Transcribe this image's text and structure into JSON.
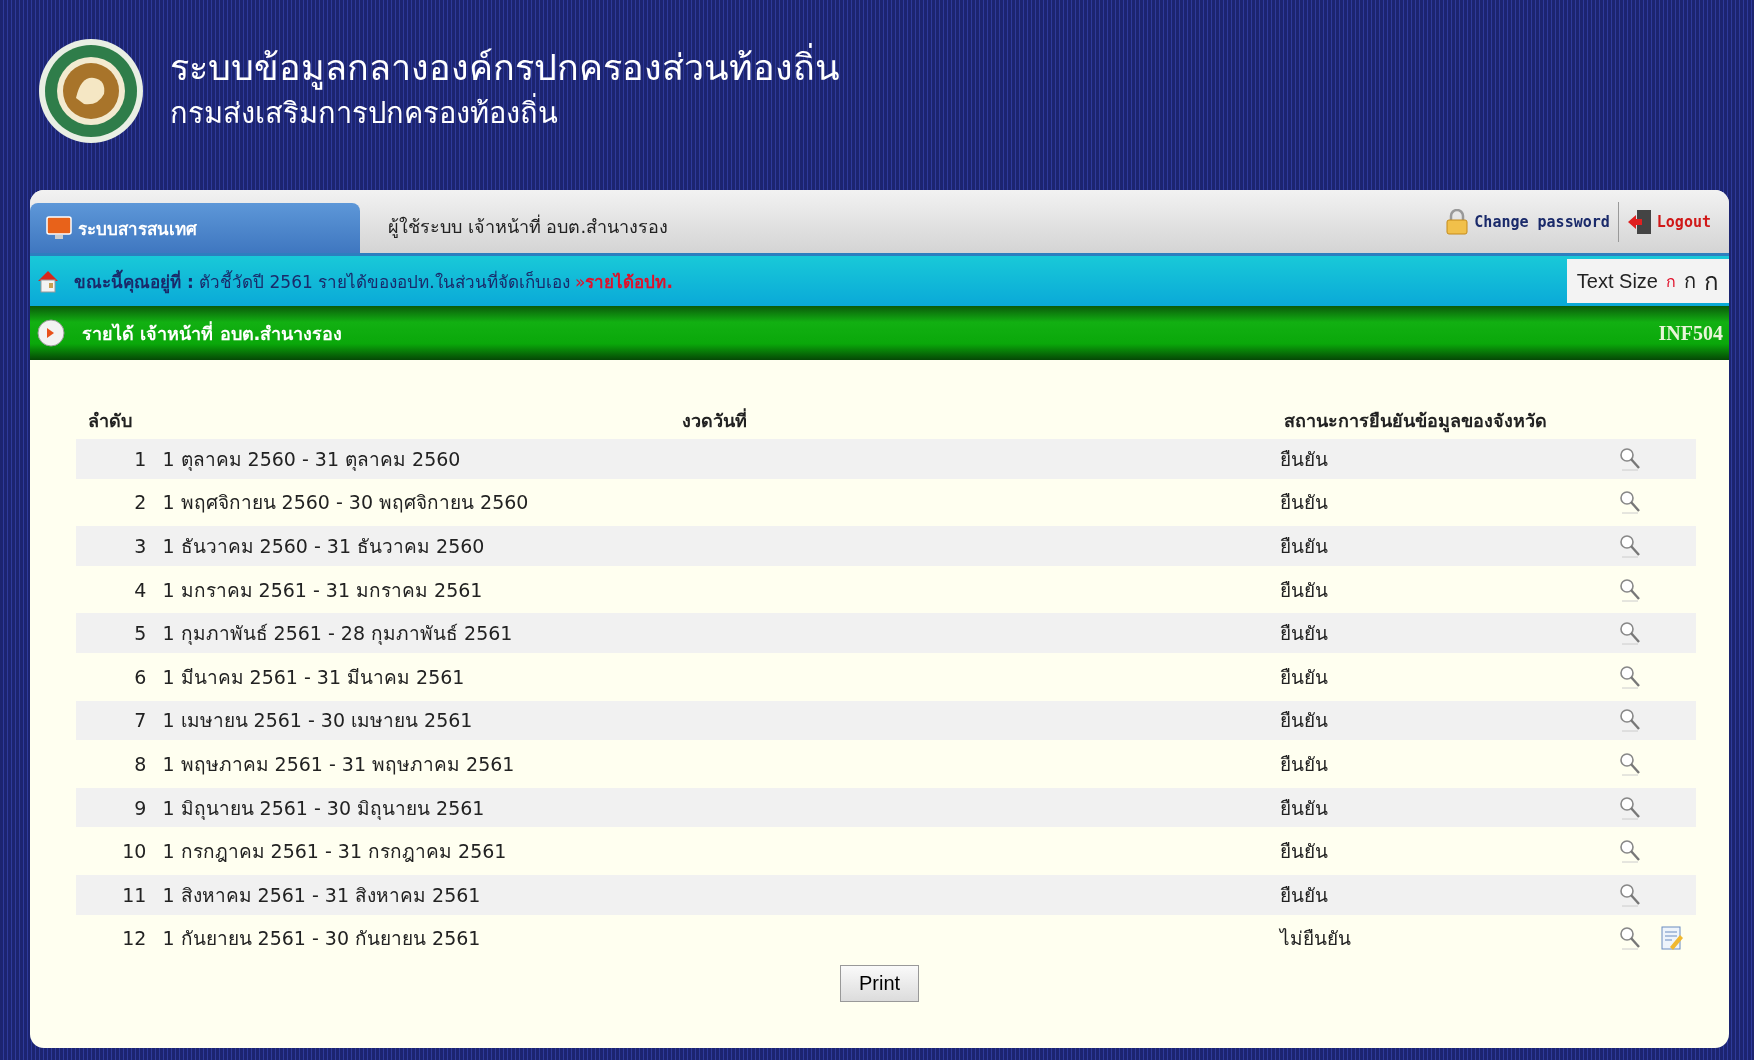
{
  "header": {
    "title": "ระบบข้อมูลกลางองค์กรปกครองส่วนท้องถิ่น",
    "subtitle": "กรมส่งเสริมการปกครองท้องถิ่น"
  },
  "tab": {
    "label": "ระบบสารสนเทศ",
    "selected": true
  },
  "user": {
    "label": "ผู้ใช้ระบบ",
    "name": "เจ้าหน้าที่ อบต.สำนางรอง"
  },
  "actions": [
    {
      "kind": "password",
      "label": "Change password"
    },
    {
      "kind": "logout",
      "label": "Logout"
    }
  ],
  "breadcrumb": {
    "label": "ขณะนี้คุณอยู่ที่ :",
    "path": "ตัวชี้วัดปี 2561 รายได้ของอปท.ในส่วนที่จัดเก็บเอง",
    "separator": "»",
    "current": "รายได้อปท."
  },
  "text_size": {
    "label": "Text Size",
    "options": [
      {
        "label": "ก",
        "selected": true
      },
      {
        "label": "ก",
        "selected": false
      },
      {
        "label": "ก",
        "selected": false
      }
    ]
  },
  "section": {
    "title": "รายได้ เจ้าหน้าที่ อบต.สำนางรอง",
    "code": "INF504"
  },
  "table": {
    "columns": [
      "ลำดับ",
      "งวดวันที่",
      "สถานะการยืนยันข้อมูลของจังหวัด"
    ],
    "rows": [
      {
        "no": "1",
        "period": "1 ตุลาคม 2560 - 31 ตุลาคม 2560",
        "status": "ยืนยัน",
        "editable": false
      },
      {
        "no": "2",
        "period": "1 พฤศจิกายน 2560 - 30 พฤศจิกายน 2560",
        "status": "ยืนยัน",
        "editable": false
      },
      {
        "no": "3",
        "period": "1 ธันวาคม 2560 - 31 ธันวาคม 2560",
        "status": "ยืนยัน",
        "editable": false
      },
      {
        "no": "4",
        "period": "1 มกราคม 2561 - 31 มกราคม 2561",
        "status": "ยืนยัน",
        "editable": false
      },
      {
        "no": "5",
        "period": "1 กุมภาพันธ์ 2561 - 28 กุมภาพันธ์ 2561",
        "status": "ยืนยัน",
        "editable": false
      },
      {
        "no": "6",
        "period": "1 มีนาคม 2561 - 31 มีนาคม 2561",
        "status": "ยืนยัน",
        "editable": false
      },
      {
        "no": "7",
        "period": "1 เมษายน 2561 - 30 เมษายน 2561",
        "status": "ยืนยัน",
        "editable": false
      },
      {
        "no": "8",
        "period": "1 พฤษภาคม 2561 - 31 พฤษภาคม 2561",
        "status": "ยืนยัน",
        "editable": false
      },
      {
        "no": "9",
        "period": "1 มิถุนายน 2561 - 30 มิถุนายน 2561",
        "status": "ยืนยัน",
        "editable": false
      },
      {
        "no": "10",
        "period": "1 กรกฎาคม 2561 - 31 กรกฎาคม 2561",
        "status": "ยืนยัน",
        "editable": false
      },
      {
        "no": "11",
        "period": "1 สิงหาคม 2561 - 31 สิงหาคม 2561",
        "status": "ยืนยัน",
        "editable": false
      },
      {
        "no": "12",
        "period": "1 กันยายน 2561 - 30 กันยายน 2561",
        "status": "ไม่ยืนยัน",
        "editable": true
      }
    ]
  },
  "print_button": "Print"
}
